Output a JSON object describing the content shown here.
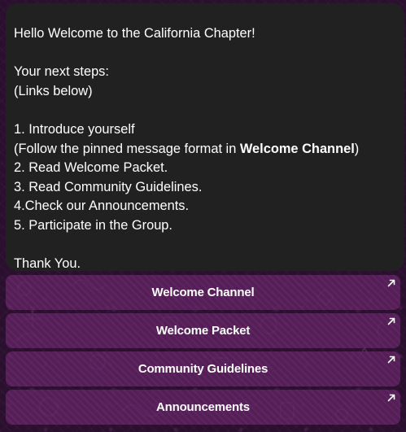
{
  "message": {
    "lines": [
      "Hello  Welcome  to the California Chapter!",
      "",
      "Your next steps:",
      "(Links below)",
      "",
      "1. Introduce yourself",
      "(Follow the pinned message format in ",
      "2. Read Welcome Packet.",
      "3. Read Community Guidelines.",
      "4.Check our Announcements.",
      "5. Participate in the Group.",
      "",
      "Thank You."
    ],
    "bold_link": "Welcome Channel",
    "paren_close": ")"
  },
  "buttons": [
    {
      "label": "Welcome Channel",
      "icon": "external-link-arrow-icon"
    },
    {
      "label": "Welcome Packet",
      "icon": "external-link-arrow-icon"
    },
    {
      "label": "Community Guidelines",
      "icon": "external-link-arrow-icon"
    },
    {
      "label": "Announcements",
      "icon": "external-link-arrow-icon"
    }
  ],
  "colors": {
    "bubble_background": "#212121",
    "button_background": "#602262",
    "chat_background": "#2a0f2e",
    "text": "#ffffff"
  }
}
